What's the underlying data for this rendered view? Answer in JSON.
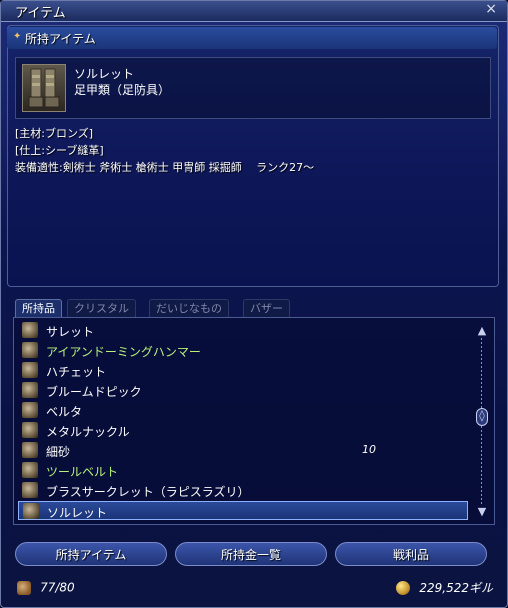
{
  "window": {
    "title": "アイテム",
    "close_glyph": "×"
  },
  "section": {
    "header": "所持アイテム",
    "header_glyph": "✦"
  },
  "item": {
    "name": "ソルレット",
    "type": "足甲類（足防具）",
    "icon": "sollerets-icon"
  },
  "details": [
    "[主材:ブロンズ]",
    "[仕上:シーブ縫革]",
    "装備適性:剣術士 斧術士 槍術士 甲冑師 採掘師　 ランク27～"
  ],
  "tabs": [
    {
      "label": "所持品",
      "active": true
    },
    {
      "label": "クリスタル",
      "active": false
    },
    {
      "label": "だいじなもの",
      "active": false
    },
    {
      "label": "バザー",
      "active": false
    }
  ],
  "list": [
    {
      "label": "サレット",
      "icon": "helmet-icon",
      "green": false,
      "qty": ""
    },
    {
      "label": "アイアンドーミングハンマー",
      "icon": "hammer-icon",
      "green": true,
      "qty": ""
    },
    {
      "label": "ハチェット",
      "icon": "hatchet-icon",
      "green": false,
      "qty": ""
    },
    {
      "label": "ブルームドピック",
      "icon": "pickaxe-icon",
      "green": false,
      "qty": ""
    },
    {
      "label": "ベルタ",
      "icon": "bell-icon",
      "green": false,
      "qty": ""
    },
    {
      "label": "メタルナックル",
      "icon": "knuckle-icon",
      "green": false,
      "qty": ""
    },
    {
      "label": "細砂",
      "icon": "sand-icon",
      "green": false,
      "qty": "10"
    },
    {
      "label": "ツールベルト",
      "icon": "belt-icon",
      "green": true,
      "qty": ""
    },
    {
      "label": "ブラスサークレット（ラピスラズリ）",
      "icon": "circlet-icon",
      "green": false,
      "qty": ""
    },
    {
      "label": "ソルレット",
      "icon": "sollerets-icon",
      "green": false,
      "qty": "",
      "selected": true
    }
  ],
  "scroll": {
    "up_glyph": "▲",
    "down_glyph": "▼",
    "thumb_glyph": "◊"
  },
  "buttons": {
    "items": "所持アイテム",
    "gil_list": "所持金一覧",
    "loot": "戦利品"
  },
  "footer": {
    "capacity": "77/80",
    "gil": "229,522ギル"
  },
  "colors": {
    "accent": "#8fb0ff",
    "green_text": "#b8f27a",
    "header_glyph": "#f0c060"
  }
}
